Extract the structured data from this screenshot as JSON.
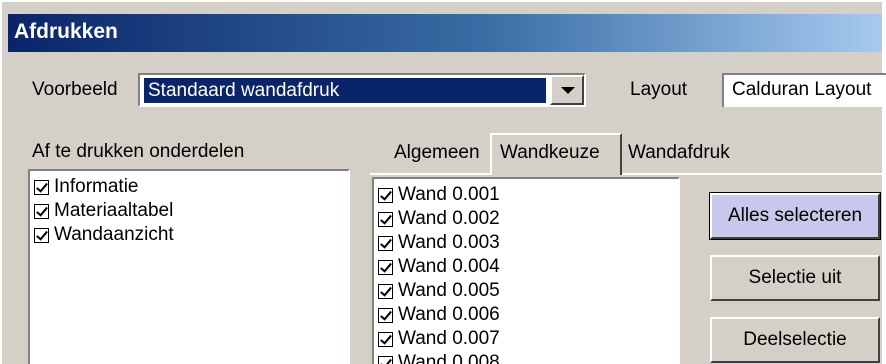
{
  "window": {
    "title": "Afdrukken"
  },
  "voorbeeld": {
    "label": "Voorbeeld",
    "value": "Standaard wandafdruk"
  },
  "layout": {
    "label": "Layout",
    "value": "Calduran Layout"
  },
  "onderdelen": {
    "label": "Af te drukken onderdelen",
    "items": [
      {
        "label": "Informatie",
        "checked": true
      },
      {
        "label": "Materiaaltabel",
        "checked": true
      },
      {
        "label": "Wandaanzicht",
        "checked": true
      }
    ]
  },
  "tabs": [
    {
      "label": "Algemeen",
      "active": false
    },
    {
      "label": "Wandkeuze",
      "active": true
    },
    {
      "label": "Wandafdruk",
      "active": false
    }
  ],
  "wanden": [
    {
      "label": "Wand 0.001",
      "checked": true
    },
    {
      "label": "Wand 0.002",
      "checked": true
    },
    {
      "label": "Wand 0.003",
      "checked": true
    },
    {
      "label": "Wand 0.004",
      "checked": true
    },
    {
      "label": "Wand 0.005",
      "checked": true
    },
    {
      "label": "Wand 0.006",
      "checked": true
    },
    {
      "label": "Wand 0.007",
      "checked": true
    },
    {
      "label": "Wand 0.008",
      "checked": true
    }
  ],
  "buttons": {
    "select_all": "Alles selecteren",
    "select_none": "Selectie uit",
    "partial": "Deelselectie"
  }
}
